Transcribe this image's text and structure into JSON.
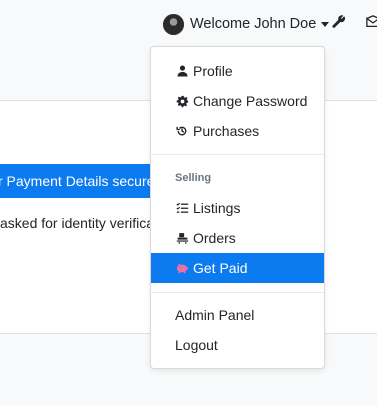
{
  "navbar": {
    "welcome_text": "Welcome John Doe"
  },
  "main": {
    "banner_text": "r Payment Details securely",
    "note_text": "asked for identity verificat"
  },
  "dropdown": {
    "items": [
      {
        "label": "Profile",
        "icon": "person-icon"
      },
      {
        "label": "Change Password",
        "icon": "gear-icon"
      },
      {
        "label": "Purchases",
        "icon": "history-icon"
      }
    ],
    "selling_header": "Selling",
    "selling_items": [
      {
        "label": "Listings",
        "icon": "list-icon"
      },
      {
        "label": "Orders",
        "icon": "shipping-icon"
      },
      {
        "label": "Get Paid",
        "icon": "piggy-bank-icon",
        "active": true
      }
    ],
    "admin_items": [
      {
        "label": "Admin Panel"
      },
      {
        "label": "Logout"
      }
    ]
  },
  "colors": {
    "accent": "#0d7bf0",
    "piggy": "#f06fa8"
  }
}
